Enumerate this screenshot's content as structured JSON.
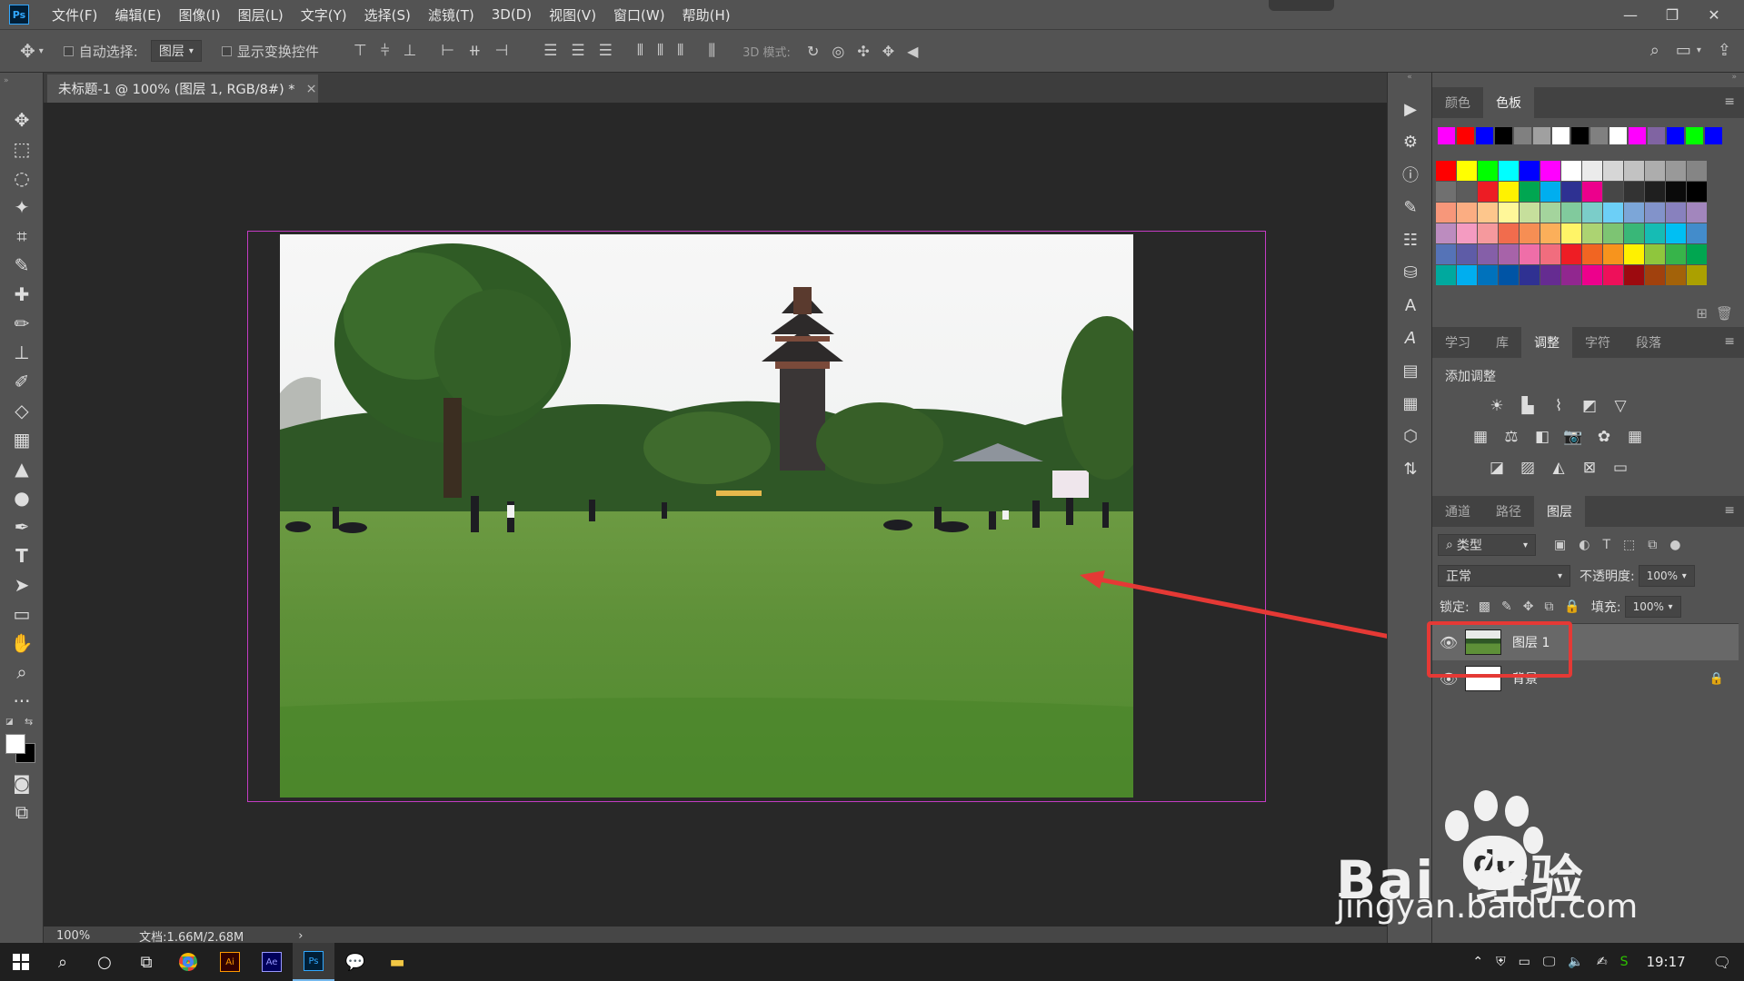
{
  "app": {
    "logo": "Ps",
    "menus": [
      "文件(F)",
      "编辑(E)",
      "图像(I)",
      "图层(L)",
      "文字(Y)",
      "选择(S)",
      "滤镜(T)",
      "3D(D)",
      "视图(V)",
      "窗口(W)",
      "帮助(H)"
    ]
  },
  "options": {
    "auto_select_label": "自动选择:",
    "auto_select_value": "图层",
    "show_transform_label": "显示变换控件",
    "mode_3d_label": "3D 模式:"
  },
  "document": {
    "tab_title": "未标题-1 @ 100% (图层 1, RGB/8#) *",
    "close": "×",
    "zoom": "100%",
    "doc_size": "文档:1.66M/2.68M",
    "status_arrow": "›"
  },
  "panels": {
    "color_tabs": [
      "颜色",
      "色板"
    ],
    "adj_tabs": [
      "学习",
      "库",
      "调整",
      "字符",
      "段落"
    ],
    "add_adjustment": "添加调整",
    "layer_tabs": [
      "通道",
      "路径",
      "图层"
    ],
    "filter_kind": "类型",
    "blend_mode": "正常",
    "opacity_label": "不透明度:",
    "opacity_value": "100%",
    "lock_label": "锁定:",
    "fill_label": "填充:",
    "fill_value": "100%",
    "layers": [
      {
        "name": "图层 1",
        "selected": true
      },
      {
        "name": "背景",
        "selected": false
      }
    ]
  },
  "swatches": {
    "row1": [
      "#ff00ff",
      "#ff0000",
      "#0000ff",
      "#000000",
      "#808080",
      "#a0a0a0",
      "#ffffff",
      "#000000",
      "#808080",
      "#ffffff",
      "#ff00ff",
      "#8064a2",
      "#0000ff",
      "#00ff00",
      "#0000ff"
    ],
    "grid": [
      [
        "#ff0000",
        "#ffff00",
        "#00ff00",
        "#00ffff",
        "#0000ff",
        "#ff00ff",
        "#ffffff",
        "#ebebeb",
        "#d6d6d6",
        "#c2c2c2",
        "#adadad",
        "#999999",
        "#858585"
      ],
      [
        "#707070",
        "#5c5c5c",
        "#ed1c24",
        "#fff200",
        "#00a651",
        "#00aeef",
        "#2e3192",
        "#ec008c",
        "#474747",
        "#333333",
        "#1f1f1f",
        "#0a0a0a",
        "#000000"
      ],
      [
        "#f7977a",
        "#fbad82",
        "#fdc68c",
        "#fff799",
        "#c6df9c",
        "#a4d49d",
        "#81ca9d",
        "#7bcdc9",
        "#6ccff7",
        "#7ca6d8",
        "#8293ca",
        "#8881be",
        "#a286bd"
      ],
      [
        "#bc8cbf",
        "#f49bc1",
        "#f5999d",
        "#f16c4d",
        "#f68e54",
        "#fbaf5a",
        "#fff467",
        "#acd372",
        "#7dc473",
        "#39b778",
        "#16bcb4",
        "#00bff3",
        "#438ccb"
      ],
      [
        "#5573b7",
        "#5e5ca7",
        "#855fa8",
        "#a763a9",
        "#ef6ea8",
        "#f16d7e",
        "#ee1d24",
        "#f16522",
        "#f7941d",
        "#fff100",
        "#8fc63d",
        "#37b44a",
        "#00a650"
      ],
      [
        "#00a99e",
        "#00aeef",
        "#0072bc",
        "#0054a5",
        "#2f3192",
        "#652c91",
        "#91278f",
        "#ed008c",
        "#ee105a",
        "#9d0a0f",
        "#a1410d",
        "#a36209",
        "#aba000"
      ]
    ]
  },
  "taskbar": {
    "time": "19:17"
  },
  "watermark": {
    "brand": "Bai  经验",
    "du": "du",
    "url": "jingyan.baidu.com"
  },
  "colors": {
    "accent": "#31a8ff",
    "highlight": "#e53935"
  }
}
